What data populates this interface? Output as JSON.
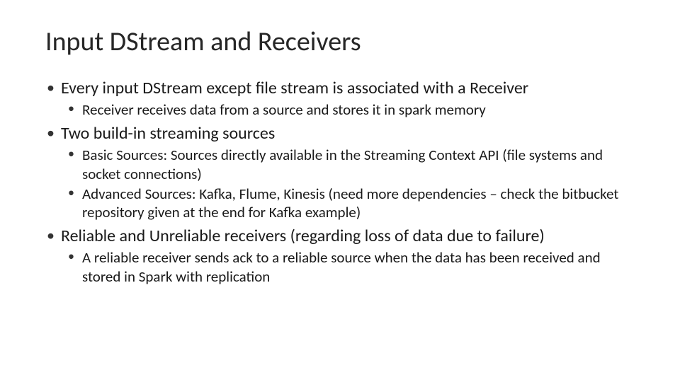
{
  "title": "Input DStream and Receivers",
  "bullets": {
    "b1": "Every input DStream except file stream is associated with a Receiver",
    "b1a": "Receiver receives data from a source and stores it in spark memory",
    "b2": "Two build-in streaming sources",
    "b2a": "Basic Sources: Sources directly available in the Streaming Context API (file systems and socket connections)",
    "b2b": "Advanced Sources: Kafka, Flume, Kinesis (need more dependencies – check the bitbucket repository given at the end for Kafka example)",
    "b3": "Reliable and Unreliable receivers (regarding loss of data due to failure)",
    "b3a": "A reliable receiver sends ack to a reliable source when the data has been received and stored in Spark with replication"
  }
}
